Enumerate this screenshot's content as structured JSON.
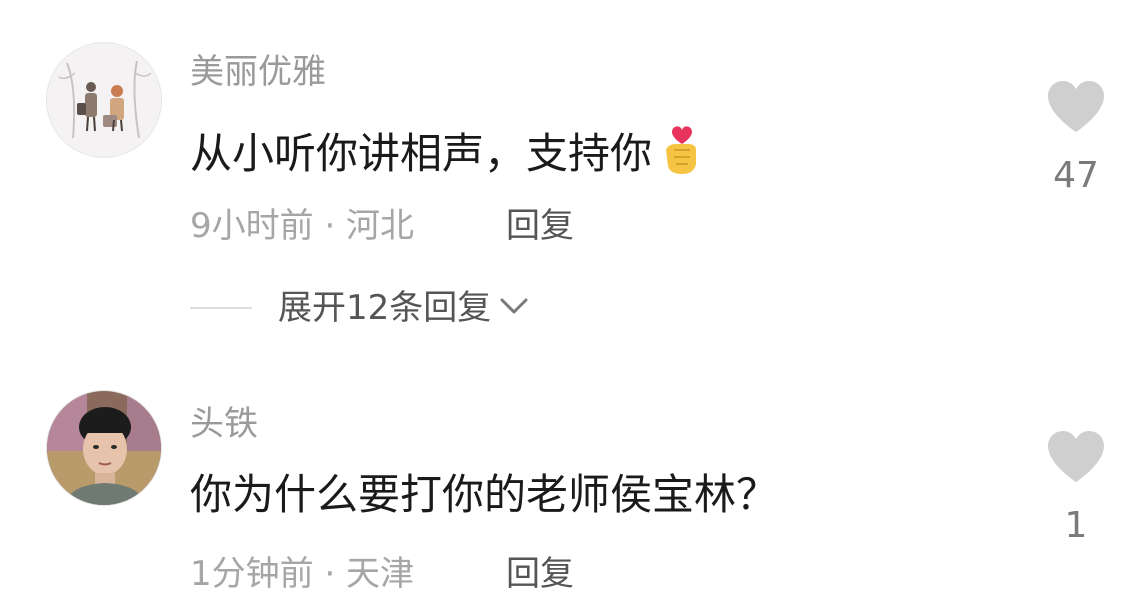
{
  "comments": [
    {
      "username": "美丽优雅",
      "text": "从小听你讲相声，支持你",
      "emoji_icon": "finger-heart-icon",
      "meta": "9小时前 · 河北",
      "reply_label": "回复",
      "likes": "47",
      "expand_label": "展开12条回复"
    },
    {
      "username": "头铁",
      "text": "你为什么要打你的老师侯宝林？",
      "meta": "1分钟前 · 天津",
      "reply_label": "回复",
      "likes": "1"
    }
  ],
  "colors": {
    "username": "#9a9a9a",
    "text": "#1a1a1a",
    "meta": "#a6a6a6",
    "action": "#555555",
    "heart": "#cfcfcf"
  }
}
